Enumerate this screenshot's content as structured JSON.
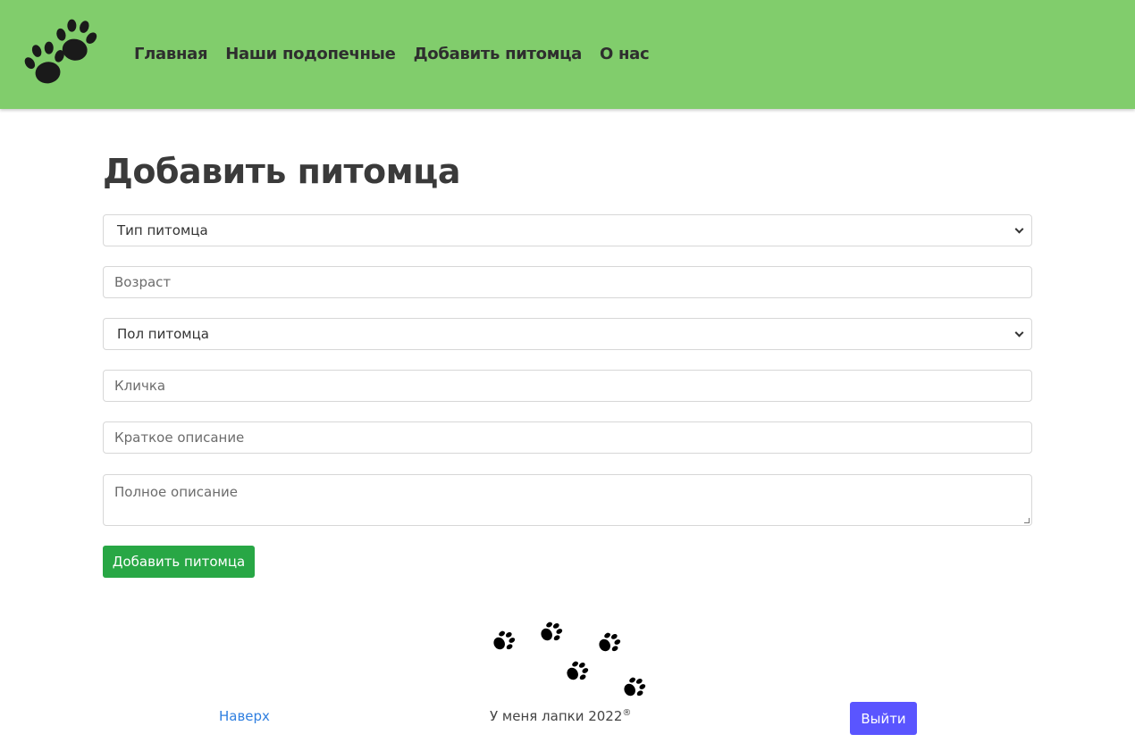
{
  "nav": {
    "logo_icon": "paw-prints-icon",
    "links": [
      "Главная",
      "Наши подопечные",
      "Добавить питомца",
      "О нас"
    ]
  },
  "main": {
    "title": "Добавить питомца",
    "form": {
      "pet_type": {
        "selected": "Тип питомца"
      },
      "age": {
        "placeholder": "Возраст",
        "value": ""
      },
      "pet_sex": {
        "selected": "Пол питомца"
      },
      "name": {
        "placeholder": "Кличка",
        "value": ""
      },
      "short_description": {
        "placeholder": "Краткое описание",
        "value": ""
      },
      "full_description": {
        "placeholder": "Полное описание",
        "value": ""
      },
      "submit_label": "Добавить питомца"
    }
  },
  "footer": {
    "paws_icon": "paw-prints-icon",
    "top_link": "Наверх",
    "copyright": "У меня лапки 2022",
    "copyright_mark": "®",
    "logout_label": "Выйти"
  },
  "colors": {
    "navbar": "#81cd6c",
    "submit_button": "#28a745",
    "logout_button": "#5a55ff",
    "link": "#2f7fe0"
  }
}
